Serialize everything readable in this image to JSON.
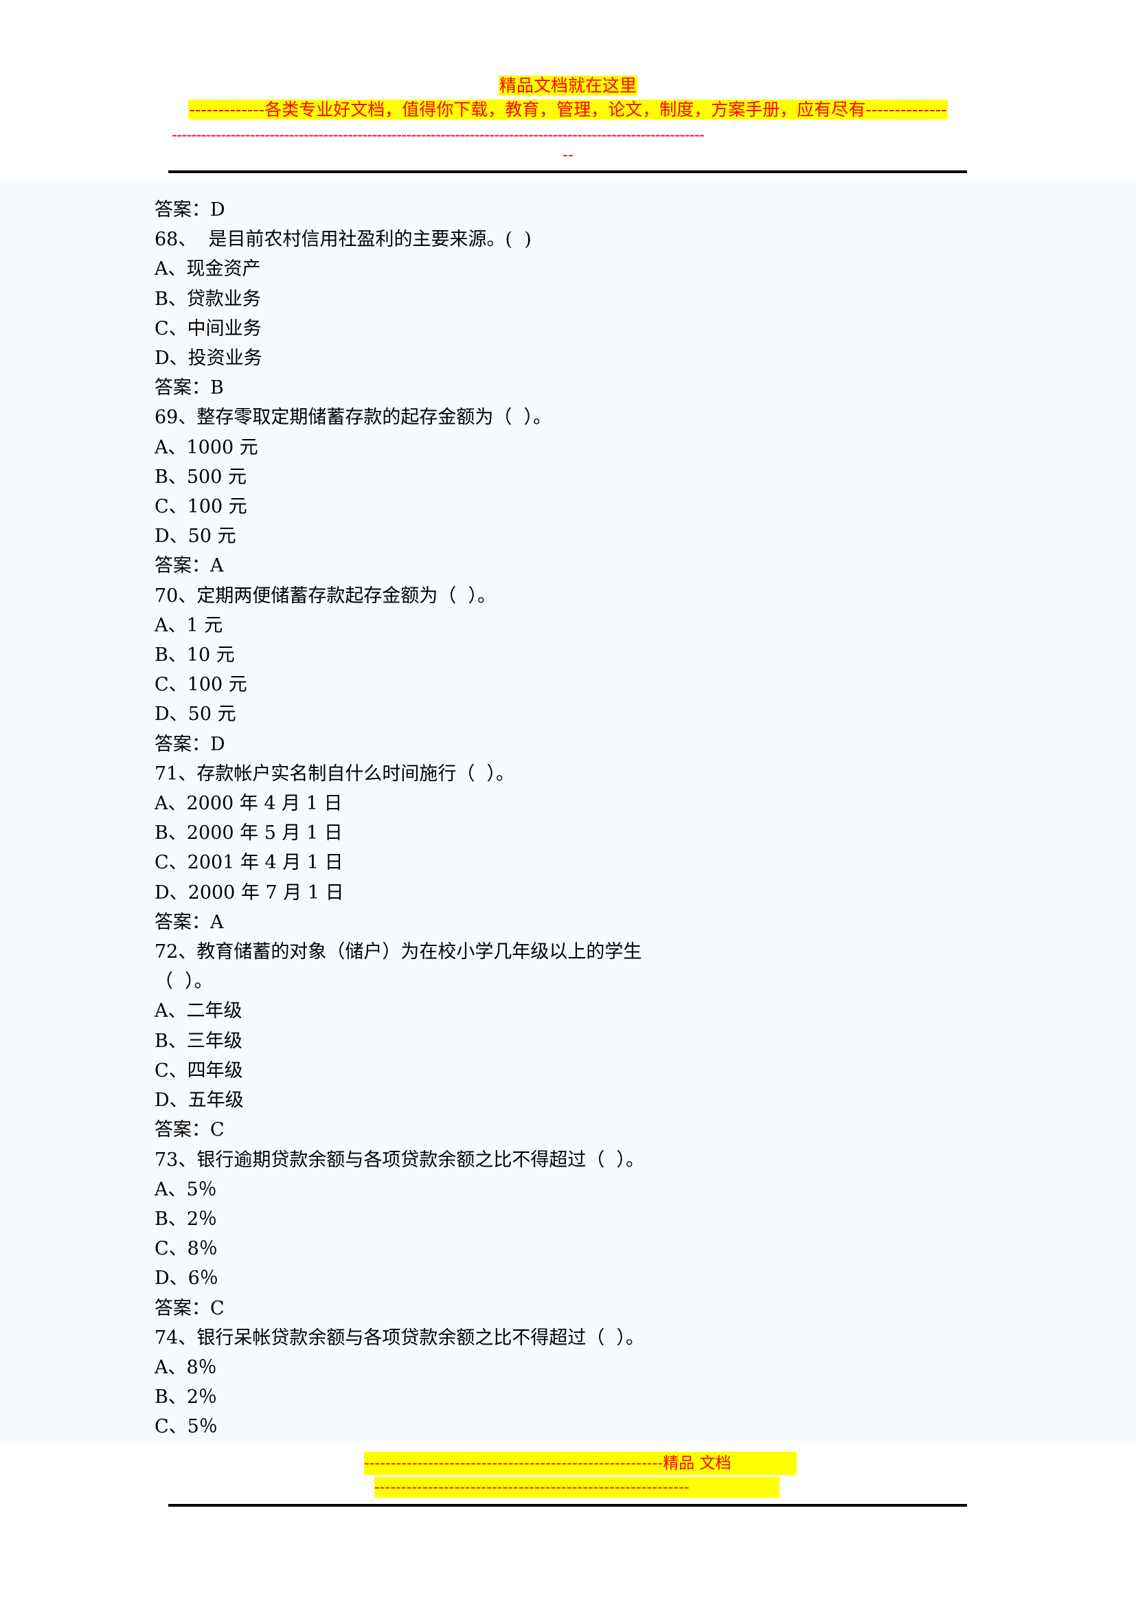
{
  "header": {
    "title_banner": "精品文档就在这里",
    "promo_banner": "-------------各类专业好文档，值得你下载，教育，管理，论文，制度，方案手册，应有尽有--------------",
    "divider_dashes": "-------------------------------------------------------------------------------------------------------------",
    "trailing_dashes": "--"
  },
  "body": {
    "lines": [
      "答案：D",
      "68、  是目前农村信用社盈利的主要来源。(  )",
      "A、现金资产",
      "B、贷款业务",
      "C、中间业务",
      "D、投资业务",
      "答案：B",
      "69、整存零取定期储蓄存款的起存金额为（  ）。",
      "A、1000 元",
      "B、500 元",
      "C、100 元",
      "D、50 元",
      "答案：A",
      "70、定期两便储蓄存款起存金额为（  ）。",
      "A、1 元",
      "B、10 元",
      "C、100 元",
      "D、50 元",
      "答案：D",
      "71、存款帐户实名制自什么时间施行（  ）。",
      "A、2000 年 4 月 1 日",
      "B、2000 年 5 月 1 日",
      "C、2001 年 4 月 1 日",
      "D、2000 年 7 月 1 日",
      "答案：A",
      "72、教育储蓄的对象（储户）为在校小学几年级以上的学生",
      "（  ）。",
      "A、二年级",
      "B、三年级",
      "C、四年级",
      "D、五年级",
      "答案：C",
      "73、银行逾期贷款余额与各项贷款余额之比不得超过（  ）。",
      "A、5％",
      "B、2％",
      "C、8％",
      "D、6％",
      "答案：C",
      "74、银行呆帐贷款余额与各项贷款余额之比不得超过（  ）。",
      "A、8％",
      "B、2％",
      "C、5％"
    ]
  },
  "footer": {
    "line1": "--------------------------------------------------------精品   文档",
    "line2": "-----------------------------------------------------------"
  },
  "colors": {
    "highlight": "#ffff00",
    "accent_red": "#ff0000",
    "page_tint": "#f7fbff",
    "text": "#000000"
  }
}
